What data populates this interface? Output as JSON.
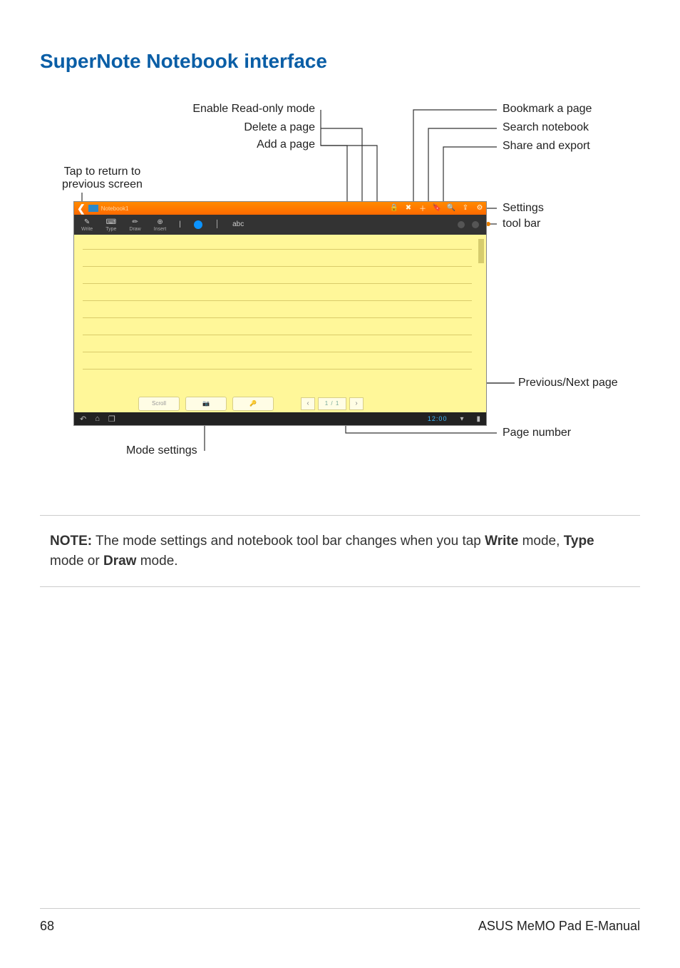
{
  "heading": "SuperNote Notebook interface",
  "callouts": {
    "enable_readonly": "Enable Read-only mode",
    "delete_page": "Delete a page",
    "add_page": "Add a page",
    "tap_return_l1": "Tap to return to",
    "tap_return_l2": "previous screen",
    "bookmark": "Bookmark a page",
    "search": "Search notebook",
    "share_export": "Share and export",
    "settings": "Settings",
    "tool_bar": "tool bar",
    "prev_next": "Previous/Next page",
    "page_number": "Page number",
    "mode_settings": "Mode settings"
  },
  "screenshot": {
    "notebook_title": "Notebook1",
    "toolbar_items": [
      "Write",
      "Type",
      "Draw",
      "Insert"
    ],
    "clock": "12:00",
    "mode_buttons": [
      "Scroll",
      "",
      ""
    ],
    "page_num_display": "1 / 1"
  },
  "note": {
    "label": "NOTE:",
    "body_before": "  The mode settings and notebook tool bar changes when you tap ",
    "write": "Write",
    "mid1": " mode, ",
    "type": "Type",
    "mid2": " mode or ",
    "draw": "Draw",
    "after": " mode."
  },
  "footer": {
    "page": "68",
    "title": "ASUS MeMO Pad E-Manual"
  }
}
